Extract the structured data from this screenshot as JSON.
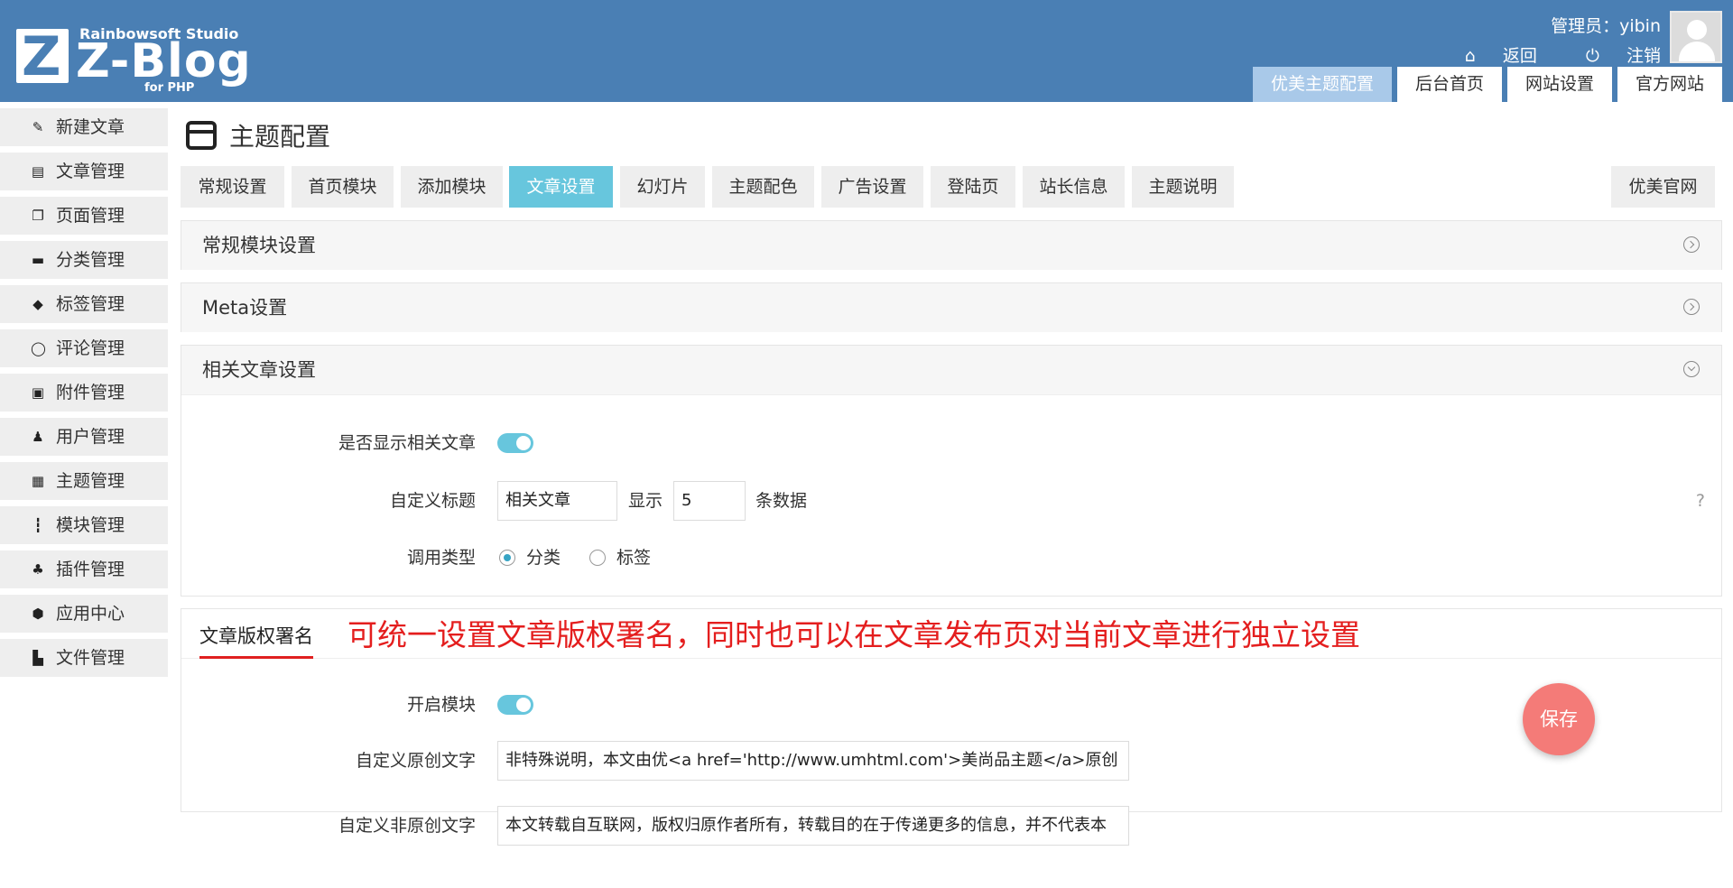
{
  "header": {
    "studio": "Rainbowsoft Studio",
    "logo_letter": "Z",
    "product": "Z-Blog",
    "php": "for PHP",
    "user_label": "管理员：yibin",
    "back_label": "返回",
    "logout_label": "注销",
    "tabs": [
      {
        "label": "优美主题配置"
      },
      {
        "label": "后台首页"
      },
      {
        "label": "网站设置"
      },
      {
        "label": "官方网站"
      }
    ]
  },
  "sidebar": {
    "items": [
      {
        "label": "新建文章"
      },
      {
        "label": "文章管理"
      },
      {
        "label": "页面管理"
      },
      {
        "label": "分类管理"
      },
      {
        "label": "标签管理"
      },
      {
        "label": "评论管理"
      },
      {
        "label": "附件管理"
      },
      {
        "label": "用户管理"
      },
      {
        "label": "主题管理"
      },
      {
        "label": "模块管理"
      },
      {
        "label": "插件管理"
      },
      {
        "label": "应用中心"
      },
      {
        "label": "文件管理"
      }
    ]
  },
  "main": {
    "title": "主题配置",
    "tabs": [
      {
        "label": "常规设置"
      },
      {
        "label": "首页模块"
      },
      {
        "label": "添加模块"
      },
      {
        "label": "文章设置"
      },
      {
        "label": "幻灯片"
      },
      {
        "label": "主题配色"
      },
      {
        "label": "广告设置"
      },
      {
        "label": "登陆页"
      },
      {
        "label": "站长信息"
      },
      {
        "label": "主题说明"
      }
    ],
    "official_tab": "优美官网",
    "panels": {
      "general": "常规模块设置",
      "meta": "Meta设置",
      "related": {
        "title": "相关文章设置",
        "show_label": "是否显示相关文章",
        "show_on": true,
        "custom_title_label": "自定义标题",
        "custom_title_value": "相关文章",
        "show_text": "显示",
        "count_value": "5",
        "count_unit": "条数据",
        "help": "?",
        "type_label": "调用类型",
        "type_options": [
          "分类",
          "标签"
        ],
        "type_selected": "分类"
      },
      "copyright": {
        "tab": "文章版权署名",
        "note": "可统一设置文章版权署名，同时也可以在文章发布页对当前文章进行独立设置",
        "enable_label": "开启模块",
        "enable_on": true,
        "original_label": "自定义原创文字",
        "original_value": "非特殊说明，本文由优<a href='http://www.umhtml.com'>美尚品主题</a>原创",
        "nonoriginal_label": "自定义非原创文字",
        "nonoriginal_value": "本文转载自互联网，版权归原作者所有，转载目的在于传递更多的信息，并不代表本"
      }
    }
  },
  "save_label": "保存",
  "colors": {
    "header": "#4a7fb4",
    "accent": "#67c6dd",
    "save": "#f47b78",
    "note": "#e41e1e"
  }
}
